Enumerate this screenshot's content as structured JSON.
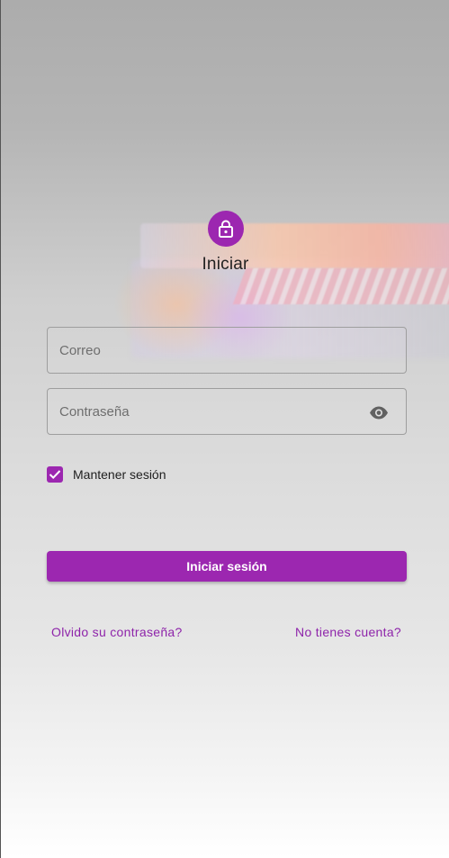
{
  "header": {
    "icon": "lock-icon",
    "title": "Iniciar"
  },
  "form": {
    "email": {
      "placeholder": "Correo",
      "value": ""
    },
    "password": {
      "placeholder": "Contraseña",
      "value": "",
      "toggle_icon": "eye-icon"
    },
    "remember": {
      "label": "Mantener sesión",
      "checked": true
    },
    "submit_label": "Iniciar sesión"
  },
  "links": {
    "forgot": "Olvido su contraseña?",
    "signup": "No tienes cuenta?"
  },
  "colors": {
    "accent": "#9c27b0",
    "link": "#8e24aa"
  }
}
